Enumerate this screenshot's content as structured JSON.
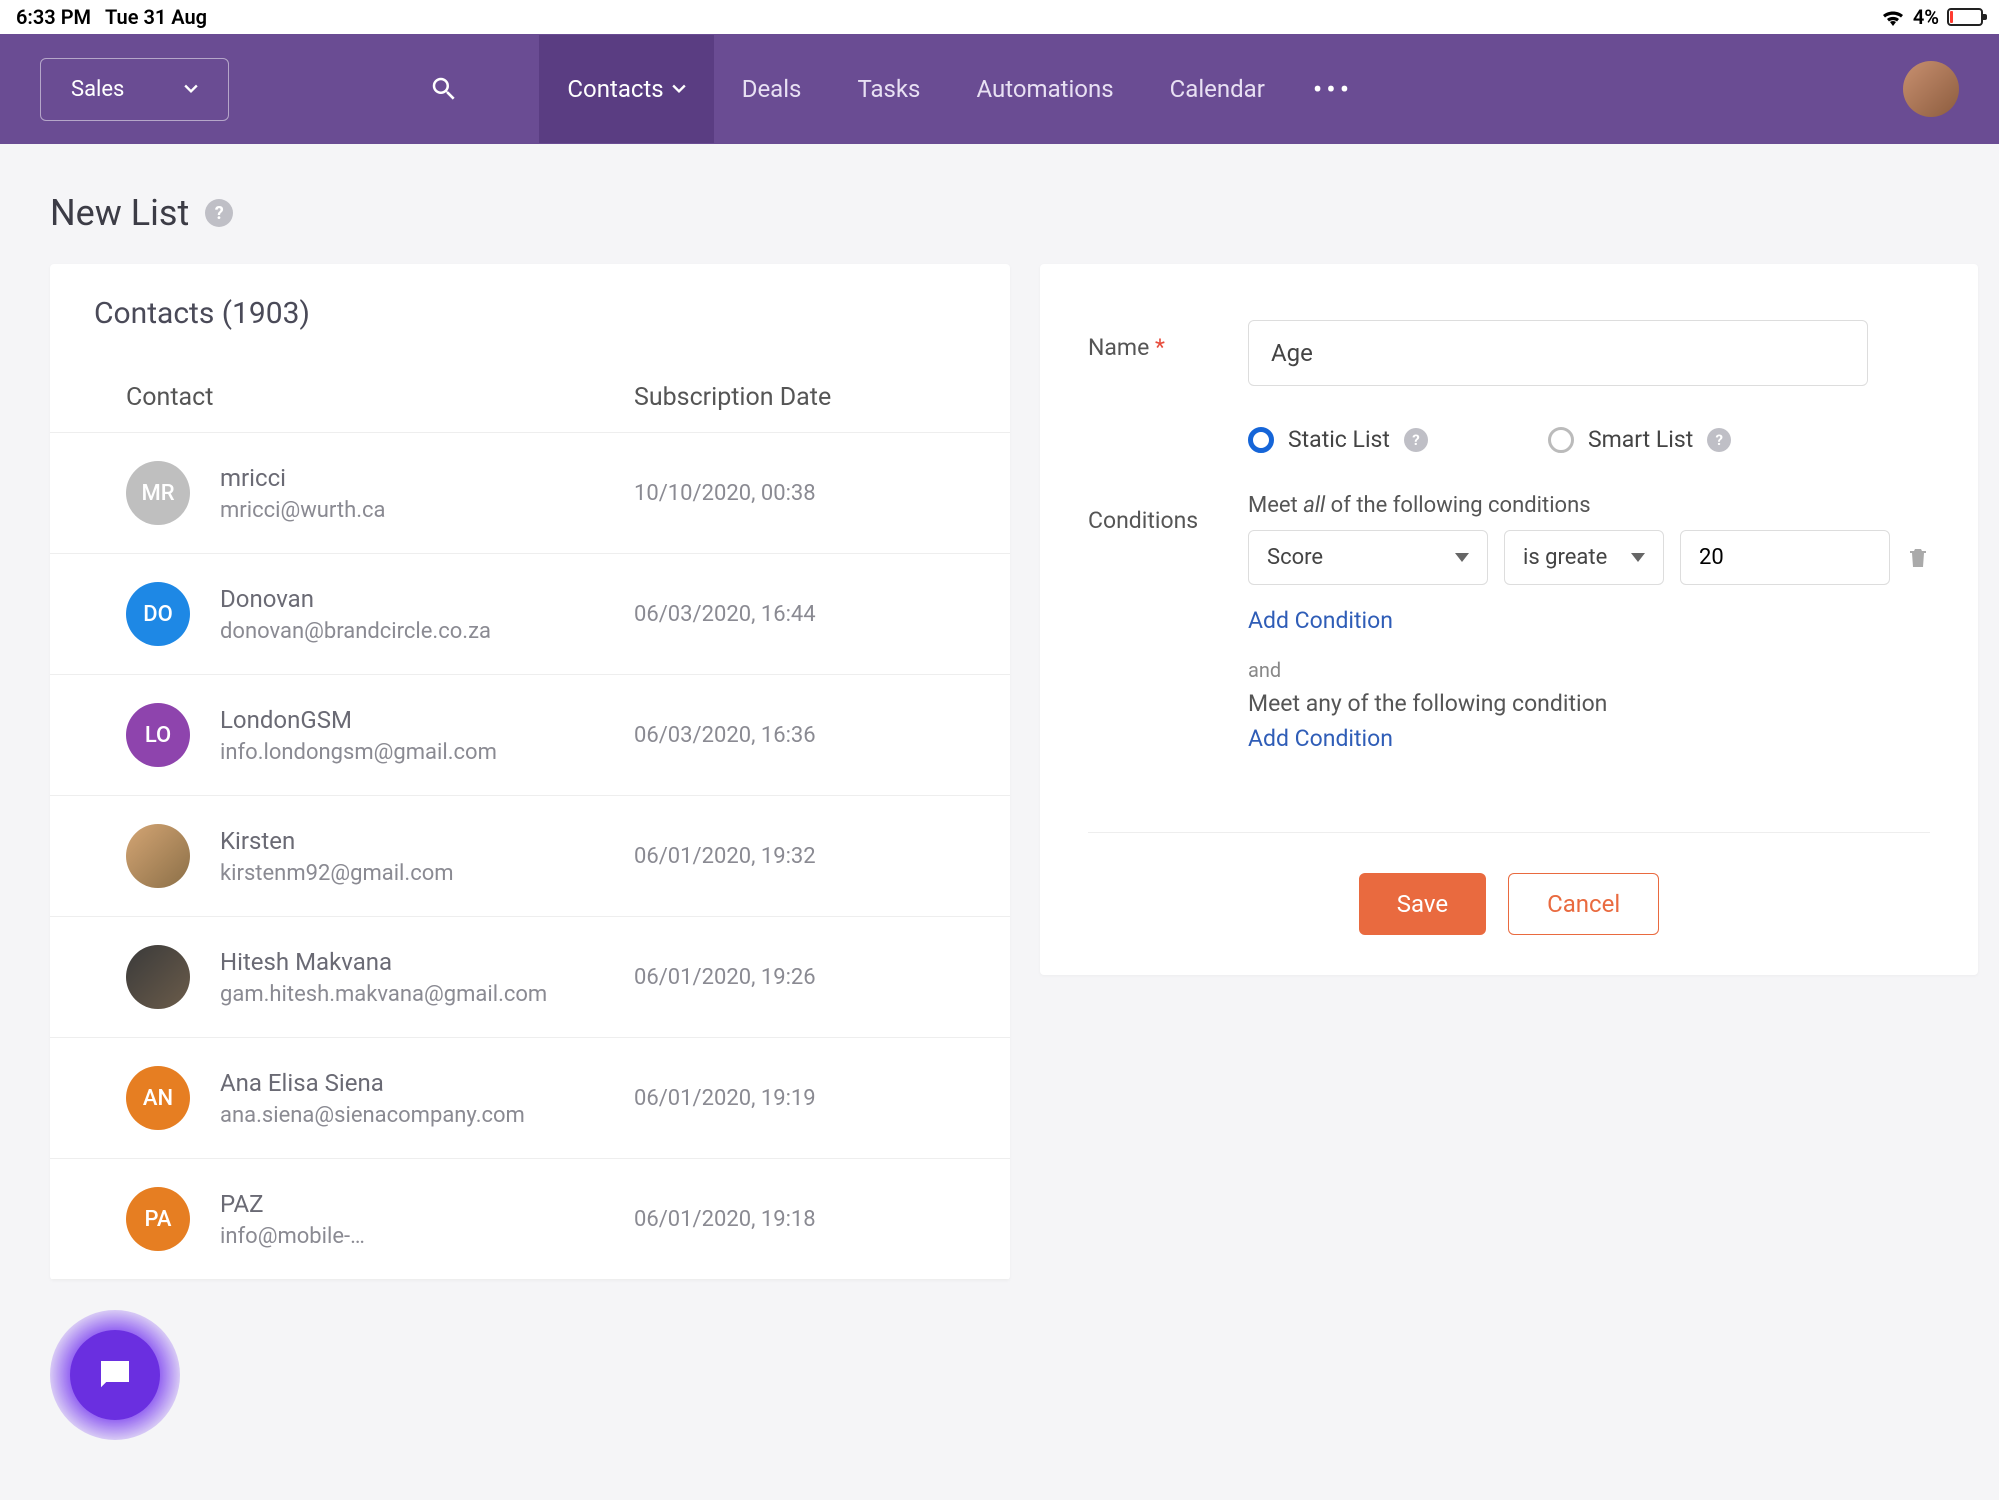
{
  "status": {
    "time": "6:33 PM",
    "date": "Tue 31 Aug",
    "battery": "4%"
  },
  "nav": {
    "selector": "Sales",
    "items": [
      "Contacts",
      "Deals",
      "Tasks",
      "Automations",
      "Calendar"
    ]
  },
  "page": {
    "title": "New List"
  },
  "contacts": {
    "heading": "Contacts (1903)",
    "columns": {
      "contact": "Contact",
      "date": "Subscription Date"
    },
    "rows": [
      {
        "initials": "MR",
        "color": "#bfbfbf",
        "name": "mricci",
        "email": "mricci@wurth.ca",
        "date": "10/10/2020, 00:38"
      },
      {
        "initials": "DO",
        "color": "#1e88e5",
        "name": "Donovan",
        "email": "donovan@brandcircle.co.za",
        "date": "06/03/2020, 16:44"
      },
      {
        "initials": "LO",
        "color": "#8e44ad",
        "name": "LondonGSM",
        "email": "info.londongsm@gmail.com",
        "date": "06/03/2020, 16:36"
      },
      {
        "initials": "",
        "color": "photo1",
        "name": "Kirsten",
        "email": "kirstenm92@gmail.com",
        "date": "06/01/2020, 19:32"
      },
      {
        "initials": "",
        "color": "photo2",
        "name": "Hitesh Makvana",
        "email": "gam.hitesh.makvana@gmail.com",
        "date": "06/01/2020, 19:26"
      },
      {
        "initials": "AN",
        "color": "#e67e22",
        "name": "Ana Elisa Siena",
        "email": "ana.siena@sienacompany.com",
        "date": "06/01/2020, 19:19"
      },
      {
        "initials": "PA",
        "color": "#e67e22",
        "name": "PAZ",
        "email": "info@mobile-…",
        "date": "06/01/2020, 19:18"
      }
    ]
  },
  "form": {
    "name_label": "Name",
    "name_value": "Age",
    "static_label": "Static List",
    "smart_label": "Smart List",
    "conditions_label": "Conditions",
    "meet_all": "Meet all of the following conditions",
    "cond_field": "Score",
    "cond_op": "is greate",
    "cond_val": "20",
    "add_condition": "Add Condition",
    "and": "and",
    "meet_any": "Meet any of the following condition",
    "save": "Save",
    "cancel": "Cancel"
  }
}
